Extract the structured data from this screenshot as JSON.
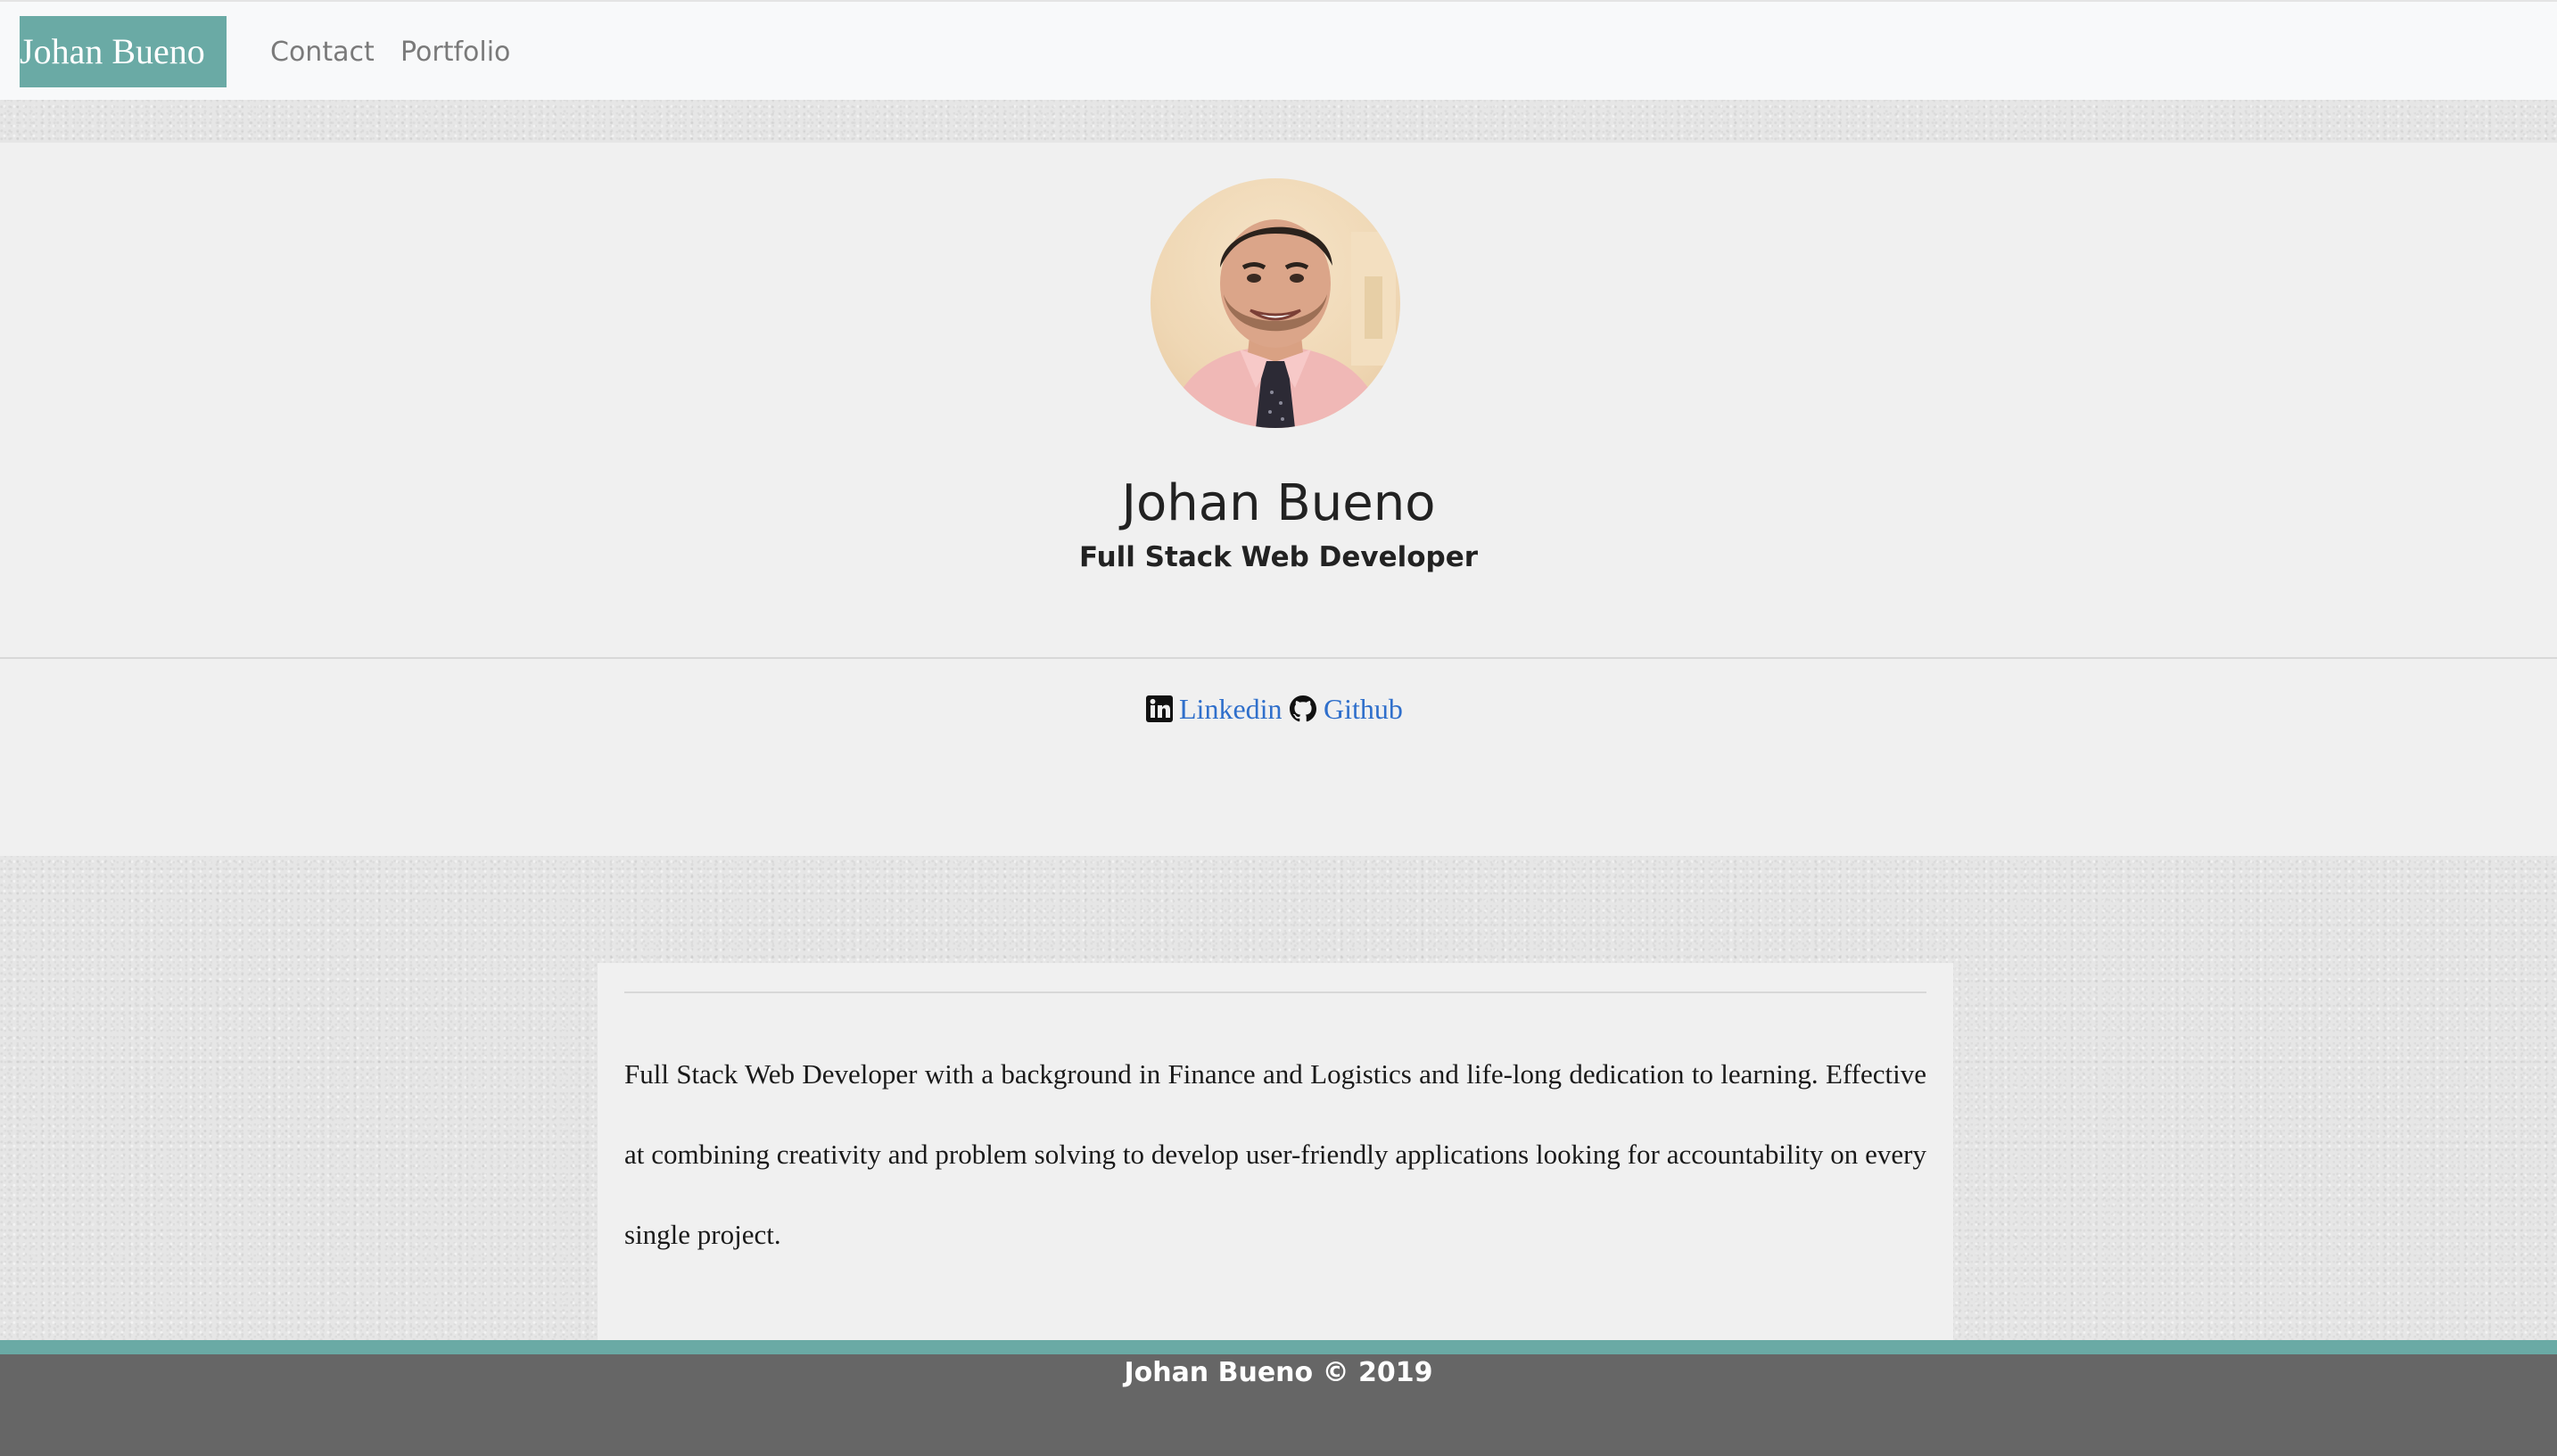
{
  "navbar": {
    "brand": "Johan Bueno",
    "links": [
      {
        "label": "Contact"
      },
      {
        "label": "Portfolio"
      }
    ]
  },
  "profile": {
    "name": "Johan Bueno",
    "role": "Full Stack Web Developer",
    "social": [
      {
        "label": "Linkedin",
        "icon": "linkedin-icon"
      },
      {
        "label": "Github",
        "icon": "github-icon"
      }
    ]
  },
  "about": {
    "text": "Full Stack Web Developer with a background in Finance and Logistics and life-long dedication to learning. Effective at combining creativity and problem solving to develop user-friendly applications looking for accountability on every single project."
  },
  "footer": {
    "text": "Johan Bueno © 2019"
  },
  "colors": {
    "accent": "#6aaaa5",
    "link": "#2f6fcb",
    "footer_bg": "#666666",
    "panel_bg": "#f0f0f0",
    "navbar_bg": "#f8f9fa"
  }
}
